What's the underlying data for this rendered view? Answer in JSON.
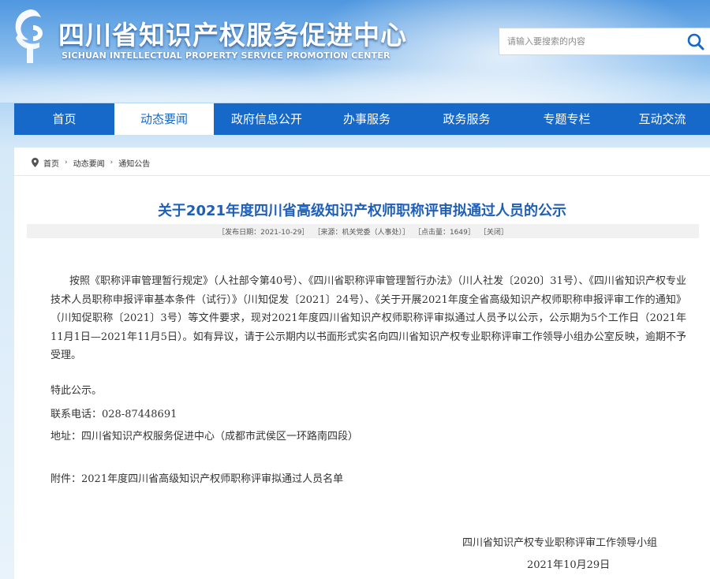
{
  "header": {
    "title": "四川省知识产权服务促进中心",
    "subtitle": "SICHUAN INTELLECTUAL PROPERTY SERVICE PROMOTION CENTER",
    "search_placeholder": "请输入要搜索的内容"
  },
  "nav": {
    "items": [
      {
        "label": "首页"
      },
      {
        "label": "动态要闻"
      },
      {
        "label": "政府信息公开"
      },
      {
        "label": "办事服务"
      },
      {
        "label": "政务服务"
      },
      {
        "label": "专题专栏"
      },
      {
        "label": "互动交流"
      }
    ],
    "active_index": 1
  },
  "breadcrumb": {
    "items": [
      "首页",
      "动态要闻",
      "通知公告"
    ]
  },
  "article": {
    "title": "关于2021年度四川省高级知识产权师职称评审拟通过人员的公示",
    "meta": {
      "date": "［发布日期：2021-10-29］",
      "source": "［来源：机关党委（人事处）］",
      "hits": "［点击量：1649］",
      "close": "［关闭］"
    },
    "body": "按照《职称评审管理暂行规定》（人社部令第40号）、《四川省职称评审管理暂行办法》（川人社发〔2020〕31号）、《四川省知识产权专业技术人员职称申报评审基本条件（试行）》（川知促发〔2021〕24号）、《关于开展2021年度全省高级知识产权师职称申报评审工作的通知》（川知促职称〔2021〕3号）等文件要求，现对2021年度四川省知识产权师职称评审拟通过人员予以公示，公示期为5个工作日（2021年11月1日—2021年11月5日）。如有异议，请于公示期内以书面形式实名向四川省知识产权专业职称评审工作领导小组办公室反映，逾期不予受理。",
    "notice": "特此公示。",
    "phone": "联系电话：028-87448691",
    "address": "地址：四川省知识产权服务促进中心（成都市武侯区一环路南四段）",
    "attachment": "附件：2021年度四川省高级知识产权师职称评审拟通过人员名单",
    "signature_org": "四川省知识产权专业职称评审工作领导小组",
    "signature_date": "2021年10月29日"
  },
  "colors": {
    "nav_bg": "#1769c9",
    "title_blue": "#1f5fb7",
    "header_sky": "#4f97e0"
  },
  "icons": {
    "logo": "sichuan-ip-emblem",
    "search": "search-icon",
    "location": "location-pin-icon",
    "separator": "chevron-right-icon"
  }
}
